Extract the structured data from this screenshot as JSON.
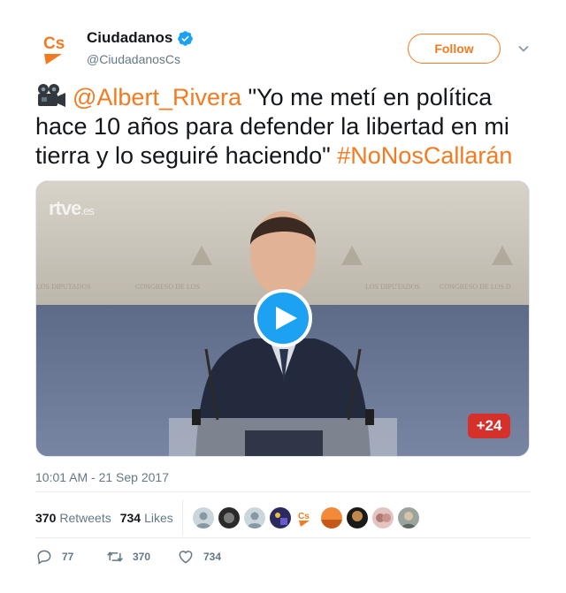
{
  "colors": {
    "accent": "#f47a20",
    "link_blue": "#1da1f2",
    "muted": "#657786",
    "text": "#14171a"
  },
  "author": {
    "name": "Ciudadanos",
    "handle": "@CiudadanosCs",
    "avatar_text": "Cs",
    "verified_icon": "verified-badge-icon"
  },
  "follow_label": "Follow",
  "tweet": {
    "emoji": "movie-camera-icon",
    "mention": "@Albert_Rivera",
    "body": " \"Yo me metí en política hace 10 años para defender la libertad en mi tierra y lo seguiré haciendo\" ",
    "hashtag": "#NoNosCallarán"
  },
  "media": {
    "watermark": "rtve",
    "watermark_suffix": ".es",
    "channel_badge": "+24",
    "play_icon": "play-icon"
  },
  "timestamp": "10:01 AM - 21 Sep 2017",
  "stats": {
    "retweets_count": "370",
    "retweets_label": "Retweets",
    "likes_count": "734",
    "likes_label": "Likes"
  },
  "liker_faces": [
    "default-avatar",
    "dark-avatar",
    "default-avatar",
    "night-avatar",
    "cs-logo-avatar",
    "orange-avatar",
    "portrait-avatar",
    "pink-avatar",
    "gray-avatar"
  ],
  "actions": {
    "reply_count": "77",
    "retweet_count": "370",
    "like_count": "734"
  }
}
